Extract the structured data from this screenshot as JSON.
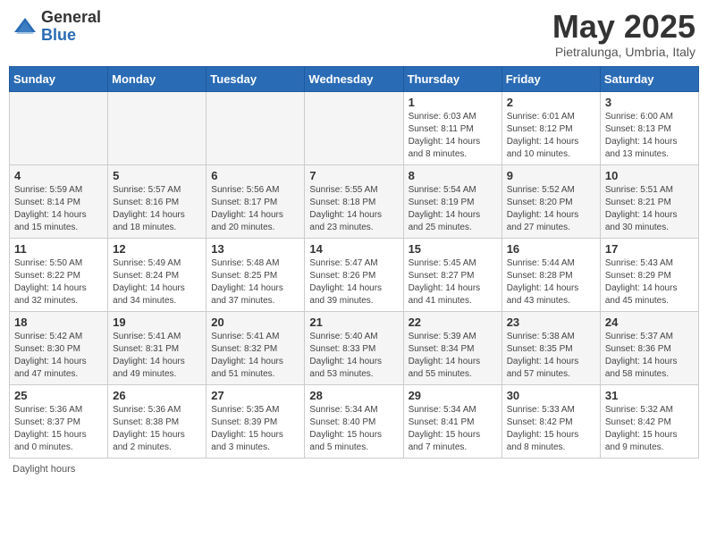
{
  "header": {
    "logo_general": "General",
    "logo_blue": "Blue",
    "month_title": "May 2025",
    "subtitle": "Pietralunga, Umbria, Italy"
  },
  "days_of_week": [
    "Sunday",
    "Monday",
    "Tuesday",
    "Wednesday",
    "Thursday",
    "Friday",
    "Saturday"
  ],
  "weeks": [
    [
      {
        "num": "",
        "info": ""
      },
      {
        "num": "",
        "info": ""
      },
      {
        "num": "",
        "info": ""
      },
      {
        "num": "",
        "info": ""
      },
      {
        "num": "1",
        "info": "Sunrise: 6:03 AM\nSunset: 8:11 PM\nDaylight: 14 hours and 8 minutes."
      },
      {
        "num": "2",
        "info": "Sunrise: 6:01 AM\nSunset: 8:12 PM\nDaylight: 14 hours and 10 minutes."
      },
      {
        "num": "3",
        "info": "Sunrise: 6:00 AM\nSunset: 8:13 PM\nDaylight: 14 hours and 13 minutes."
      }
    ],
    [
      {
        "num": "4",
        "info": "Sunrise: 5:59 AM\nSunset: 8:14 PM\nDaylight: 14 hours and 15 minutes."
      },
      {
        "num": "5",
        "info": "Sunrise: 5:57 AM\nSunset: 8:16 PM\nDaylight: 14 hours and 18 minutes."
      },
      {
        "num": "6",
        "info": "Sunrise: 5:56 AM\nSunset: 8:17 PM\nDaylight: 14 hours and 20 minutes."
      },
      {
        "num": "7",
        "info": "Sunrise: 5:55 AM\nSunset: 8:18 PM\nDaylight: 14 hours and 23 minutes."
      },
      {
        "num": "8",
        "info": "Sunrise: 5:54 AM\nSunset: 8:19 PM\nDaylight: 14 hours and 25 minutes."
      },
      {
        "num": "9",
        "info": "Sunrise: 5:52 AM\nSunset: 8:20 PM\nDaylight: 14 hours and 27 minutes."
      },
      {
        "num": "10",
        "info": "Sunrise: 5:51 AM\nSunset: 8:21 PM\nDaylight: 14 hours and 30 minutes."
      }
    ],
    [
      {
        "num": "11",
        "info": "Sunrise: 5:50 AM\nSunset: 8:22 PM\nDaylight: 14 hours and 32 minutes."
      },
      {
        "num": "12",
        "info": "Sunrise: 5:49 AM\nSunset: 8:24 PM\nDaylight: 14 hours and 34 minutes."
      },
      {
        "num": "13",
        "info": "Sunrise: 5:48 AM\nSunset: 8:25 PM\nDaylight: 14 hours and 37 minutes."
      },
      {
        "num": "14",
        "info": "Sunrise: 5:47 AM\nSunset: 8:26 PM\nDaylight: 14 hours and 39 minutes."
      },
      {
        "num": "15",
        "info": "Sunrise: 5:45 AM\nSunset: 8:27 PM\nDaylight: 14 hours and 41 minutes."
      },
      {
        "num": "16",
        "info": "Sunrise: 5:44 AM\nSunset: 8:28 PM\nDaylight: 14 hours and 43 minutes."
      },
      {
        "num": "17",
        "info": "Sunrise: 5:43 AM\nSunset: 8:29 PM\nDaylight: 14 hours and 45 minutes."
      }
    ],
    [
      {
        "num": "18",
        "info": "Sunrise: 5:42 AM\nSunset: 8:30 PM\nDaylight: 14 hours and 47 minutes."
      },
      {
        "num": "19",
        "info": "Sunrise: 5:41 AM\nSunset: 8:31 PM\nDaylight: 14 hours and 49 minutes."
      },
      {
        "num": "20",
        "info": "Sunrise: 5:41 AM\nSunset: 8:32 PM\nDaylight: 14 hours and 51 minutes."
      },
      {
        "num": "21",
        "info": "Sunrise: 5:40 AM\nSunset: 8:33 PM\nDaylight: 14 hours and 53 minutes."
      },
      {
        "num": "22",
        "info": "Sunrise: 5:39 AM\nSunset: 8:34 PM\nDaylight: 14 hours and 55 minutes."
      },
      {
        "num": "23",
        "info": "Sunrise: 5:38 AM\nSunset: 8:35 PM\nDaylight: 14 hours and 57 minutes."
      },
      {
        "num": "24",
        "info": "Sunrise: 5:37 AM\nSunset: 8:36 PM\nDaylight: 14 hours and 58 minutes."
      }
    ],
    [
      {
        "num": "25",
        "info": "Sunrise: 5:36 AM\nSunset: 8:37 PM\nDaylight: 15 hours and 0 minutes."
      },
      {
        "num": "26",
        "info": "Sunrise: 5:36 AM\nSunset: 8:38 PM\nDaylight: 15 hours and 2 minutes."
      },
      {
        "num": "27",
        "info": "Sunrise: 5:35 AM\nSunset: 8:39 PM\nDaylight: 15 hours and 3 minutes."
      },
      {
        "num": "28",
        "info": "Sunrise: 5:34 AM\nSunset: 8:40 PM\nDaylight: 15 hours and 5 minutes."
      },
      {
        "num": "29",
        "info": "Sunrise: 5:34 AM\nSunset: 8:41 PM\nDaylight: 15 hours and 7 minutes."
      },
      {
        "num": "30",
        "info": "Sunrise: 5:33 AM\nSunset: 8:42 PM\nDaylight: 15 hours and 8 minutes."
      },
      {
        "num": "31",
        "info": "Sunrise: 5:32 AM\nSunset: 8:42 PM\nDaylight: 15 hours and 9 minutes."
      }
    ]
  ],
  "footer": {
    "note": "Daylight hours"
  }
}
